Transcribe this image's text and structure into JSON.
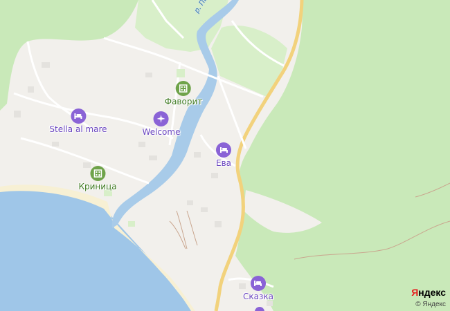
{
  "map": {
    "colors": {
      "forest": "#c9e9b9",
      "urban": "#f2f0ec",
      "sea": "#9fc6e8",
      "river": "#a8cbe9",
      "beach": "#f7f0d4",
      "highway": "#f2d27c",
      "road": "#ffffff",
      "poi_green": "#6fa34a",
      "poi_purple": "#8a63d6"
    },
    "river_label": "р. Пшада",
    "pois": [
      {
        "id": "favorit",
        "name": "Фаворит",
        "icon": "hotel-icon",
        "color": "#6fa34a"
      },
      {
        "id": "stella",
        "name": "Stella al mare",
        "icon": "bed-icon",
        "color": "#8a63d6"
      },
      {
        "id": "welcome",
        "name": "Welcome",
        "icon": "airplane-icon",
        "color": "#8a63d6"
      },
      {
        "id": "eva",
        "name": "Ева",
        "icon": "bed-icon",
        "color": "#8a63d6"
      },
      {
        "id": "krinitsa",
        "name": "Криница",
        "icon": "hotel-icon",
        "color": "#6fa34a"
      },
      {
        "id": "skazka",
        "name": "Сказка",
        "icon": "bed-icon",
        "color": "#8a63d6"
      }
    ],
    "brand": {
      "first_letter": "Я",
      "rest": "ндекс"
    },
    "copyright": "© Яндекс"
  }
}
